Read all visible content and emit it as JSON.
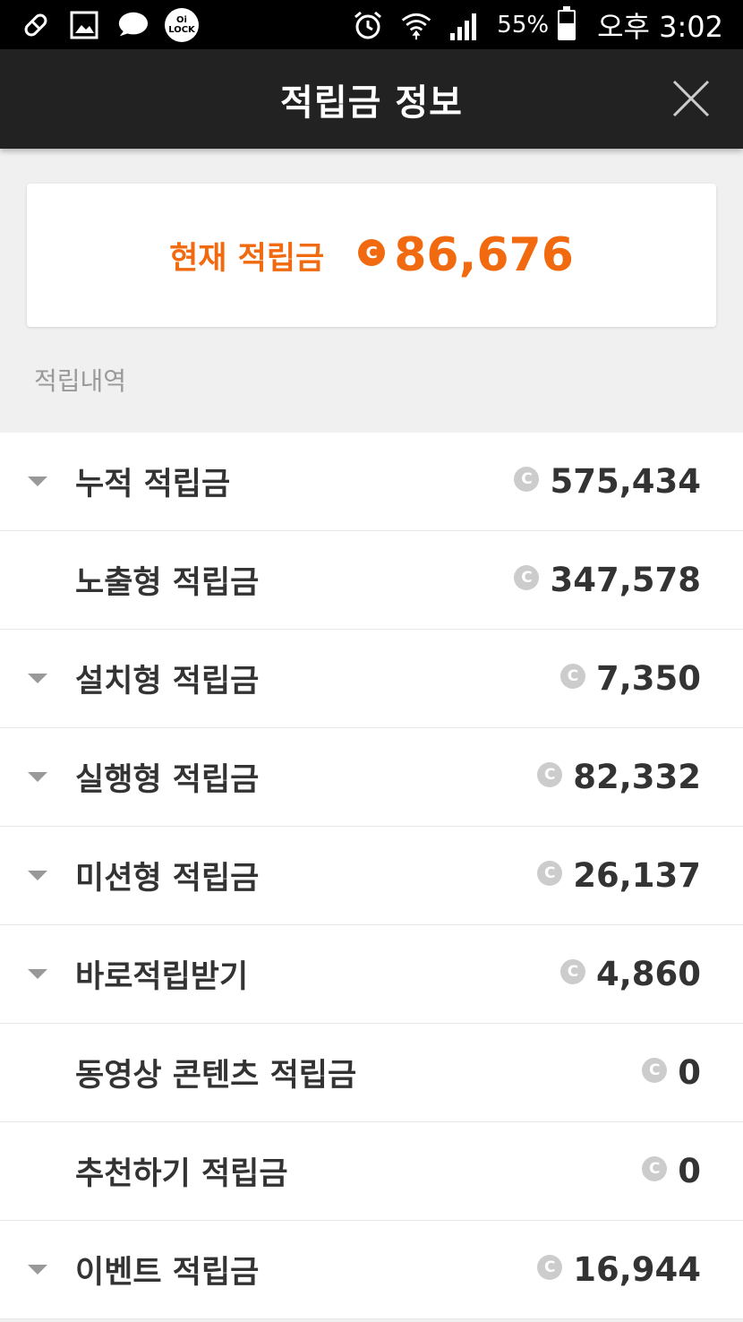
{
  "status_bar": {
    "lock_app_text": "Oi\nLOCK",
    "battery_pct": "55%",
    "battery_level": 0.55,
    "clock": "오후 3:02"
  },
  "header": {
    "title": "적립금 정보"
  },
  "balance": {
    "label": "현재 적립금",
    "coin_symbol": "C",
    "value": "86,676",
    "accent_color": "#f26a10"
  },
  "history": {
    "section_label": "적립내역",
    "items": [
      {
        "label": "누적 적립금",
        "value": "575,434",
        "expandable": true
      },
      {
        "label": "노출형 적립금",
        "value": "347,578",
        "expandable": false
      },
      {
        "label": "설치형 적립금",
        "value": "7,350",
        "expandable": true
      },
      {
        "label": "실행형 적립금",
        "value": "82,332",
        "expandable": true
      },
      {
        "label": "미션형 적립금",
        "value": "26,137",
        "expandable": true
      },
      {
        "label": "바로적립받기",
        "value": "4,860",
        "expandable": true
      },
      {
        "label": "동영상 콘텐츠 적립금",
        "value": "0",
        "expandable": false
      },
      {
        "label": "추천하기 적립금",
        "value": "0",
        "expandable": false
      },
      {
        "label": "이벤트 적립금",
        "value": "16,944",
        "expandable": true
      }
    ]
  }
}
